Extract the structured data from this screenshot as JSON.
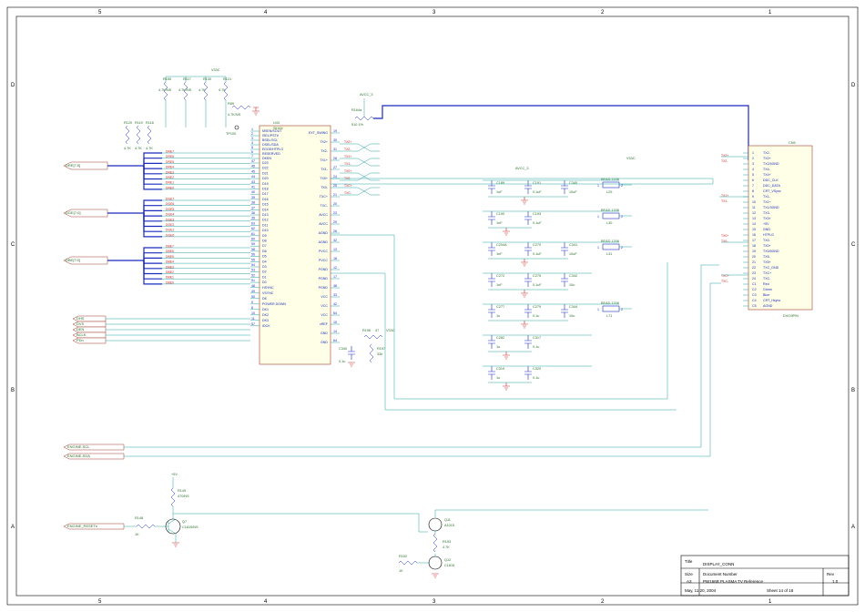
{
  "frame": {
    "cols": [
      "5",
      "4",
      "3",
      "2",
      "1"
    ],
    "rows": [
      "D",
      "C",
      "B",
      "A"
    ],
    "date": "May, 11 20, 2004",
    "sheet": "Sheet    14    of    18"
  },
  "title_block": {
    "title_lbl": "Title",
    "title": "DISPLAY_CONN",
    "size_lbl": "Size",
    "size": "A3",
    "doc_lbl": "Document Number",
    "doc": "PW166B PLASMA TV Reference",
    "rev_lbl": "Rev",
    "rev": "1.0"
  },
  "ic": {
    "ref": "U43",
    "part": "Sii164",
    "left": [
      {
        "n": "1",
        "t": "MSEN/SOUT"
      },
      {
        "n": "2",
        "t": "ISEL/PST#"
      },
      {
        "n": "3",
        "t": "BSEL/SCL"
      },
      {
        "n": "4",
        "t": "DSEL/SDA"
      },
      {
        "n": "5",
        "t": "EDGE/HTPLG"
      },
      {
        "n": "6",
        "t": "RESERVED"
      },
      {
        "n": "7",
        "t": "DKEN"
      },
      {
        "n": "47",
        "t": "D23"
      },
      {
        "n": "46",
        "t": "D22"
      },
      {
        "n": "45",
        "t": "D21"
      },
      {
        "n": "44",
        "t": "D20"
      },
      {
        "n": "43",
        "t": "D19"
      },
      {
        "n": "41",
        "t": "D18"
      },
      {
        "n": "40",
        "t": "D17"
      },
      {
        "n": "39",
        "t": "D16"
      },
      {
        "n": "38",
        "t": "D15"
      },
      {
        "n": "37",
        "t": "D14"
      },
      {
        "n": "36",
        "t": "D13"
      },
      {
        "n": "35",
        "t": "D12"
      },
      {
        "n": "63",
        "t": "D11"
      },
      {
        "n": "62",
        "t": "D10"
      },
      {
        "n": "61",
        "t": "D9"
      },
      {
        "n": "60",
        "t": "D8"
      },
      {
        "n": "59",
        "t": "D7"
      },
      {
        "n": "58",
        "t": "D6"
      },
      {
        "n": "56",
        "t": "D5"
      },
      {
        "n": "55",
        "t": "D4"
      },
      {
        "n": "54",
        "t": "D3"
      },
      {
        "n": "53",
        "t": "D2"
      },
      {
        "n": "52",
        "t": "D1"
      },
      {
        "n": "51",
        "t": "D0"
      },
      {
        "n": "48",
        "t": "HSYNC"
      },
      {
        "n": "49",
        "t": "VSYNC"
      },
      {
        "n": "50",
        "t": "DE"
      },
      {
        "n": "9",
        "t": "POWER DOWN"
      },
      {
        "n": "8",
        "t": "DK1"
      },
      {
        "n": "10",
        "t": "DK2"
      },
      {
        "n": "11",
        "t": "DK3"
      },
      {
        "n": "57",
        "t": "IDCK"
      }
    ],
    "right": [
      {
        "n": "19",
        "t": "EXT_SWING"
      },
      {
        "n": "30",
        "t": "TX2+"
      },
      {
        "n": "31",
        "t": "TX2-"
      },
      {
        "n": "28",
        "t": "TX1+"
      },
      {
        "n": "27",
        "t": "TX1-"
      },
      {
        "n": "24",
        "t": "TX0+"
      },
      {
        "n": "25",
        "t": "TX0-"
      },
      {
        "n": "21",
        "t": "TXC+"
      },
      {
        "n": "20",
        "t": "TXC-"
      },
      {
        "n": "23",
        "t": "AVCC"
      },
      {
        "n": "29",
        "t": "AVCC"
      },
      {
        "n": "26",
        "t": "AGND"
      },
      {
        "n": "32",
        "t": "AGND"
      },
      {
        "n": "13",
        "t": "PVCC"
      },
      {
        "n": "18",
        "t": "PVCC"
      },
      {
        "n": "12",
        "t": "PGND"
      },
      {
        "n": "17",
        "t": "PGND"
      },
      {
        "n": "48",
        "t": "PGND"
      },
      {
        "n": "33",
        "t": "VCC"
      },
      {
        "n": "42",
        "t": "VCC"
      },
      {
        "n": "64",
        "t": "VCC"
      },
      {
        "n": "15",
        "t": "vREF"
      },
      {
        "n": "14",
        "t": "GND"
      },
      {
        "n": "64",
        "t": "GND"
      }
    ]
  },
  "pullups": [
    {
      "ref": "R155",
      "val": "4.7K/NS"
    },
    {
      "ref": "R117",
      "val": "4.7K/NS"
    },
    {
      "ref": "R130",
      "val": "4.7K"
    },
    {
      "ref": "R121",
      "val": "4.7K"
    }
  ],
  "r89": {
    "ref": "R89",
    "val": "4.7K/NS"
  },
  "r164a": {
    "ref": "R164a",
    "val": "510 1%"
  },
  "tp": {
    "ref": "TP100"
  },
  "in_pullups": [
    {
      "ref": "R120",
      "val": "4.7K"
    },
    {
      "ref": "R119",
      "val": "4.7K"
    },
    {
      "ref": "R118",
      "val": "4.7K"
    }
  ],
  "vref": {
    "c": {
      "ref": "C340",
      "val": "0.1u"
    },
    "r": {
      "ref": "R197",
      "val": "33k"
    },
    "rs": {
      "ref": "R196",
      "val": "47"
    }
  },
  "avcc_label": "AVCC_3",
  "v33_label": "V33C",
  "v5_label": "+5V",
  "cap_rows": [
    {
      "l": "L29",
      "lt": "BEAD 1206",
      "c": [
        {
          "ref": "C189",
          "val": "1uF"
        },
        {
          "ref": "C191",
          "val": "0.1uF"
        },
        {
          "ref": "C340",
          "val": "10uF"
        }
      ]
    },
    {
      "l": "L30",
      "lt": "BEAD 1206",
      "c": [
        {
          "ref": "C190",
          "val": "1nF"
        },
        {
          "ref": "C193",
          "val": "0.1uF"
        }
      ]
    },
    {
      "l": "L31",
      "lt": "BEAD 1206",
      "c": [
        {
          "ref": "C204A",
          "val": "1nF"
        },
        {
          "ref": "C270",
          "val": "0.1uF"
        },
        {
          "ref": "C341",
          "val": "10uF"
        }
      ]
    },
    {
      "l": "",
      "lt": "",
      "c": [
        {
          "ref": "C272",
          "val": "1nF"
        },
        {
          "ref": "C275",
          "val": "0.1uF"
        },
        {
          "ref": "C342",
          "val": "10u"
        }
      ]
    },
    {
      "l": "L71",
      "lt": "BEAD 1206",
      "c": [
        {
          "ref": "C277",
          "val": "1u"
        },
        {
          "ref": "C279",
          "val": "0.1u"
        },
        {
          "ref": "C344",
          "val": "10u"
        }
      ]
    },
    {
      "l": "",
      "lt": "",
      "c": [
        {
          "ref": "C282",
          "val": "1u"
        },
        {
          "ref": "C317",
          "val": "0.1u"
        }
      ]
    },
    {
      "l": "",
      "lt": "",
      "c": [
        {
          "ref": "C319",
          "val": "1u"
        },
        {
          "ref": "C320",
          "val": "0.1u"
        }
      ]
    }
  ],
  "busses": [
    {
      "name": "DRE[7:0]",
      "sig": [
        "DRE7",
        "DRE6",
        "DRE5",
        "DRE4",
        "DRE3",
        "DRE2",
        "DRE1",
        "DRE0"
      ]
    },
    {
      "name": "DGE[7:0]",
      "sig": [
        "DGE7",
        "DGE6",
        "DGE5",
        "DGE4",
        "DGE3",
        "DGE2",
        "DGE1",
        "DGE0"
      ]
    },
    {
      "name": "DBE[7:0]",
      "sig": [
        "DBE7",
        "DBE6",
        "DBE5",
        "DBE4",
        "DBE3",
        "DBE2",
        "DBE1",
        "DBE0"
      ]
    }
  ],
  "ctrl_ports": [
    "DHS",
    "DVS",
    "DEN",
    "BCLK",
    "PDn"
  ],
  "bottom_ports": [
    "ENGINE-SCL",
    "ENGINE-SDA",
    "ENGINE_RESETn"
  ],
  "tx_nets": [
    "TX2+",
    "TX2-",
    "TX1+",
    "TX1-",
    "TX0+",
    "TX0-",
    "TXC+",
    "TXC-"
  ],
  "reset": {
    "r149": {
      "ref": "R149",
      "val": "470/NS"
    },
    "r148": {
      "ref": "R148",
      "val": "1K"
    },
    "q7": {
      "ref": "Q7",
      "val": "C1815/NS"
    }
  },
  "level": {
    "q11": {
      "ref": "Q11",
      "val": "A1015"
    },
    "q12": {
      "ref": "Q12",
      "val": "C1815"
    },
    "r153": {
      "ref": "R153",
      "val": "4.7K"
    },
    "r152": {
      "ref": "R152",
      "val": "1K"
    }
  },
  "conn": {
    "ref": "DVI29PIN",
    "title": "CN5",
    "pins": [
      {
        "n": "1",
        "t": "TX2-"
      },
      {
        "n": "2",
        "t": "TX2+"
      },
      {
        "n": "3",
        "t": "TX2/4GND"
      },
      {
        "n": "4",
        "t": "TX4-"
      },
      {
        "n": "5",
        "t": "TX4+"
      },
      {
        "n": "6",
        "t": "DDC_CLK"
      },
      {
        "n": "7",
        "t": "DDC_DATA"
      },
      {
        "n": "8",
        "t": "CRT_VSync"
      },
      {
        "n": "9",
        "t": "TX1-"
      },
      {
        "n": "10",
        "t": "TX1+"
      },
      {
        "n": "11",
        "t": "TX1/3GND"
      },
      {
        "n": "12",
        "t": "TX3-"
      },
      {
        "n": "13",
        "t": "TX3+"
      },
      {
        "n": "14",
        "t": "+5V"
      },
      {
        "n": "15",
        "t": "GND"
      },
      {
        "n": "16",
        "t": "HTPLG"
      },
      {
        "n": "17",
        "t": "TX0-"
      },
      {
        "n": "18",
        "t": "TX0+"
      },
      {
        "n": "19",
        "t": "TX0/5GND"
      },
      {
        "n": "20",
        "t": "TX5-"
      },
      {
        "n": "21",
        "t": "TX5+"
      },
      {
        "n": "22",
        "t": "TXC_GND"
      },
      {
        "n": "23",
        "t": "TXC+"
      },
      {
        "n": "24",
        "t": "TXC-"
      },
      {
        "n": "C1",
        "t": "Red"
      },
      {
        "n": "C2",
        "t": "Green"
      },
      {
        "n": "C3",
        "t": "Blue"
      },
      {
        "n": "C4",
        "t": "CRT_Hsync"
      },
      {
        "n": "C5",
        "t": "AGND"
      }
    ]
  }
}
